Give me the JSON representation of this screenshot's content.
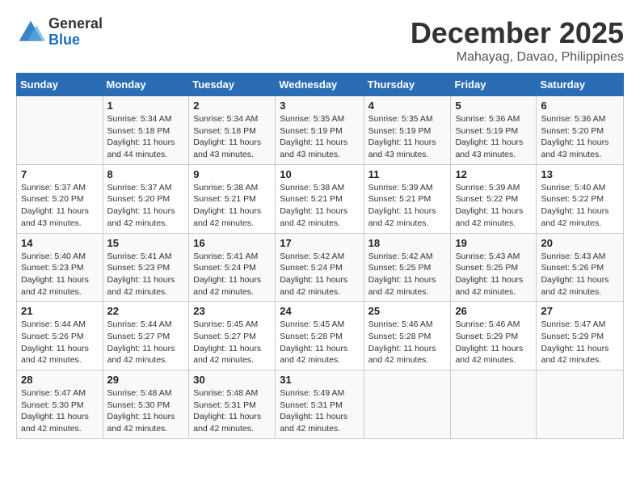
{
  "logo": {
    "general": "General",
    "blue": "Blue"
  },
  "title": "December 2025",
  "location": "Mahayag, Davao, Philippines",
  "headers": [
    "Sunday",
    "Monday",
    "Tuesday",
    "Wednesday",
    "Thursday",
    "Friday",
    "Saturday"
  ],
  "weeks": [
    [
      {
        "day": "",
        "sunrise": "",
        "sunset": "",
        "daylight": ""
      },
      {
        "day": "1",
        "sunrise": "Sunrise: 5:34 AM",
        "sunset": "Sunset: 5:18 PM",
        "daylight": "Daylight: 11 hours and 44 minutes."
      },
      {
        "day": "2",
        "sunrise": "Sunrise: 5:34 AM",
        "sunset": "Sunset: 5:18 PM",
        "daylight": "Daylight: 11 hours and 43 minutes."
      },
      {
        "day": "3",
        "sunrise": "Sunrise: 5:35 AM",
        "sunset": "Sunset: 5:19 PM",
        "daylight": "Daylight: 11 hours and 43 minutes."
      },
      {
        "day": "4",
        "sunrise": "Sunrise: 5:35 AM",
        "sunset": "Sunset: 5:19 PM",
        "daylight": "Daylight: 11 hours and 43 minutes."
      },
      {
        "day": "5",
        "sunrise": "Sunrise: 5:36 AM",
        "sunset": "Sunset: 5:19 PM",
        "daylight": "Daylight: 11 hours and 43 minutes."
      },
      {
        "day": "6",
        "sunrise": "Sunrise: 5:36 AM",
        "sunset": "Sunset: 5:20 PM",
        "daylight": "Daylight: 11 hours and 43 minutes."
      }
    ],
    [
      {
        "day": "7",
        "sunrise": "Sunrise: 5:37 AM",
        "sunset": "Sunset: 5:20 PM",
        "daylight": "Daylight: 11 hours and 43 minutes."
      },
      {
        "day": "8",
        "sunrise": "Sunrise: 5:37 AM",
        "sunset": "Sunset: 5:20 PM",
        "daylight": "Daylight: 11 hours and 42 minutes."
      },
      {
        "day": "9",
        "sunrise": "Sunrise: 5:38 AM",
        "sunset": "Sunset: 5:21 PM",
        "daylight": "Daylight: 11 hours and 42 minutes."
      },
      {
        "day": "10",
        "sunrise": "Sunrise: 5:38 AM",
        "sunset": "Sunset: 5:21 PM",
        "daylight": "Daylight: 11 hours and 42 minutes."
      },
      {
        "day": "11",
        "sunrise": "Sunrise: 5:39 AM",
        "sunset": "Sunset: 5:21 PM",
        "daylight": "Daylight: 11 hours and 42 minutes."
      },
      {
        "day": "12",
        "sunrise": "Sunrise: 5:39 AM",
        "sunset": "Sunset: 5:22 PM",
        "daylight": "Daylight: 11 hours and 42 minutes."
      },
      {
        "day": "13",
        "sunrise": "Sunrise: 5:40 AM",
        "sunset": "Sunset: 5:22 PM",
        "daylight": "Daylight: 11 hours and 42 minutes."
      }
    ],
    [
      {
        "day": "14",
        "sunrise": "Sunrise: 5:40 AM",
        "sunset": "Sunset: 5:23 PM",
        "daylight": "Daylight: 11 hours and 42 minutes."
      },
      {
        "day": "15",
        "sunrise": "Sunrise: 5:41 AM",
        "sunset": "Sunset: 5:23 PM",
        "daylight": "Daylight: 11 hours and 42 minutes."
      },
      {
        "day": "16",
        "sunrise": "Sunrise: 5:41 AM",
        "sunset": "Sunset: 5:24 PM",
        "daylight": "Daylight: 11 hours and 42 minutes."
      },
      {
        "day": "17",
        "sunrise": "Sunrise: 5:42 AM",
        "sunset": "Sunset: 5:24 PM",
        "daylight": "Daylight: 11 hours and 42 minutes."
      },
      {
        "day": "18",
        "sunrise": "Sunrise: 5:42 AM",
        "sunset": "Sunset: 5:25 PM",
        "daylight": "Daylight: 11 hours and 42 minutes."
      },
      {
        "day": "19",
        "sunrise": "Sunrise: 5:43 AM",
        "sunset": "Sunset: 5:25 PM",
        "daylight": "Daylight: 11 hours and 42 minutes."
      },
      {
        "day": "20",
        "sunrise": "Sunrise: 5:43 AM",
        "sunset": "Sunset: 5:26 PM",
        "daylight": "Daylight: 11 hours and 42 minutes."
      }
    ],
    [
      {
        "day": "21",
        "sunrise": "Sunrise: 5:44 AM",
        "sunset": "Sunset: 5:26 PM",
        "daylight": "Daylight: 11 hours and 42 minutes."
      },
      {
        "day": "22",
        "sunrise": "Sunrise: 5:44 AM",
        "sunset": "Sunset: 5:27 PM",
        "daylight": "Daylight: 11 hours and 42 minutes."
      },
      {
        "day": "23",
        "sunrise": "Sunrise: 5:45 AM",
        "sunset": "Sunset: 5:27 PM",
        "daylight": "Daylight: 11 hours and 42 minutes."
      },
      {
        "day": "24",
        "sunrise": "Sunrise: 5:45 AM",
        "sunset": "Sunset: 5:28 PM",
        "daylight": "Daylight: 11 hours and 42 minutes."
      },
      {
        "day": "25",
        "sunrise": "Sunrise: 5:46 AM",
        "sunset": "Sunset: 5:28 PM",
        "daylight": "Daylight: 11 hours and 42 minutes."
      },
      {
        "day": "26",
        "sunrise": "Sunrise: 5:46 AM",
        "sunset": "Sunset: 5:29 PM",
        "daylight": "Daylight: 11 hours and 42 minutes."
      },
      {
        "day": "27",
        "sunrise": "Sunrise: 5:47 AM",
        "sunset": "Sunset: 5:29 PM",
        "daylight": "Daylight: 11 hours and 42 minutes."
      }
    ],
    [
      {
        "day": "28",
        "sunrise": "Sunrise: 5:47 AM",
        "sunset": "Sunset: 5:30 PM",
        "daylight": "Daylight: 11 hours and 42 minutes."
      },
      {
        "day": "29",
        "sunrise": "Sunrise: 5:48 AM",
        "sunset": "Sunset: 5:30 PM",
        "daylight": "Daylight: 11 hours and 42 minutes."
      },
      {
        "day": "30",
        "sunrise": "Sunrise: 5:48 AM",
        "sunset": "Sunset: 5:31 PM",
        "daylight": "Daylight: 11 hours and 42 minutes."
      },
      {
        "day": "31",
        "sunrise": "Sunrise: 5:49 AM",
        "sunset": "Sunset: 5:31 PM",
        "daylight": "Daylight: 11 hours and 42 minutes."
      },
      {
        "day": "",
        "sunrise": "",
        "sunset": "",
        "daylight": ""
      },
      {
        "day": "",
        "sunrise": "",
        "sunset": "",
        "daylight": ""
      },
      {
        "day": "",
        "sunrise": "",
        "sunset": "",
        "daylight": ""
      }
    ]
  ]
}
